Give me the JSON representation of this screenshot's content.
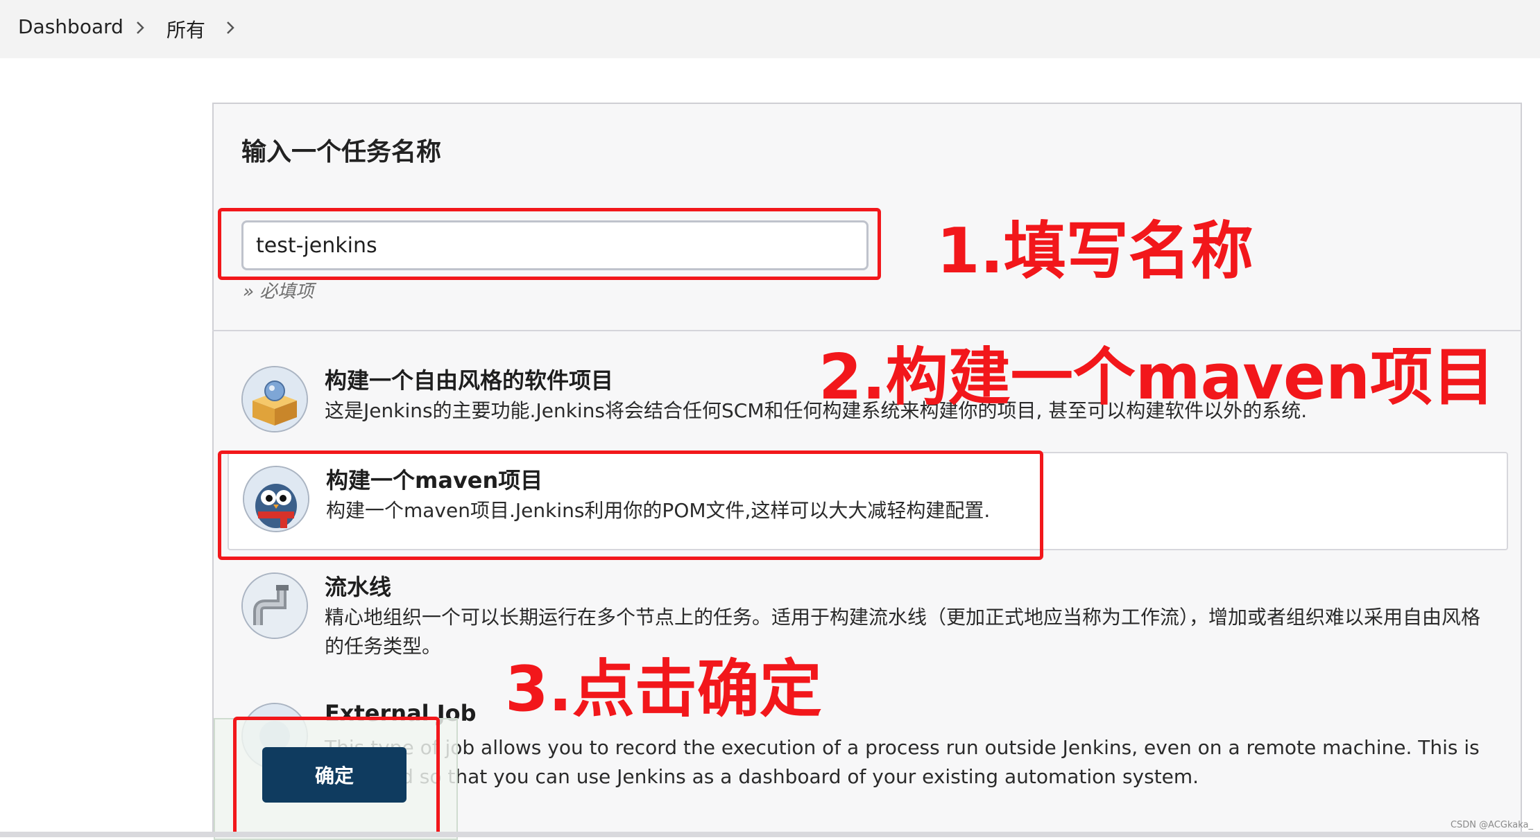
{
  "breadcrumb": {
    "items": [
      "Dashboard",
      "所有"
    ]
  },
  "form": {
    "heading": "输入一个任务名称",
    "item_name_value": "test-jenkins",
    "required_hint": "» 必填项"
  },
  "job_types": [
    {
      "title": "构建一个自由风格的软件项目",
      "description": "这是Jenkins的主要功能.Jenkins将会结合任何SCM和任何构建系统来构建你的项目, 甚至可以构建软件以外的系统.",
      "icon": "freestyle-box-icon",
      "selected": false
    },
    {
      "title": "构建一个maven项目",
      "description": "构建一个maven项目.Jenkins利用你的POM文件,这样可以大大减轻构建配置.",
      "icon": "maven-owl-icon",
      "selected": true
    },
    {
      "title": "流水线",
      "description": "精心地组织一个可以长期运行在多个节点上的任务。适用于构建流水线（更加正式地应当称为工作流），增加或者组织难以采用自由风格的任务类型。",
      "icon": "pipeline-pipe-icon",
      "selected": false
    },
    {
      "title": "External Job",
      "description": "This type of job allows you to record the execution of a process run outside Jenkins, even on a remote machine. This is designed so that you can use Jenkins as a dashboard of your existing automation system.",
      "icon": "external-job-icon",
      "selected": false
    }
  ],
  "confirm_button": {
    "label": "确定"
  },
  "annotations": {
    "step1": "1.填写名称",
    "step2": "2.构建一个maven项目",
    "step3": "3.点击确定",
    "color": "#f2171b"
  },
  "watermark": "CSDN @ACGkaka_",
  "colors": {
    "primary_button": "#0f3b5f",
    "breadcrumb_bg": "#f3f3f3",
    "panel_bg": "#f7f7f8"
  }
}
